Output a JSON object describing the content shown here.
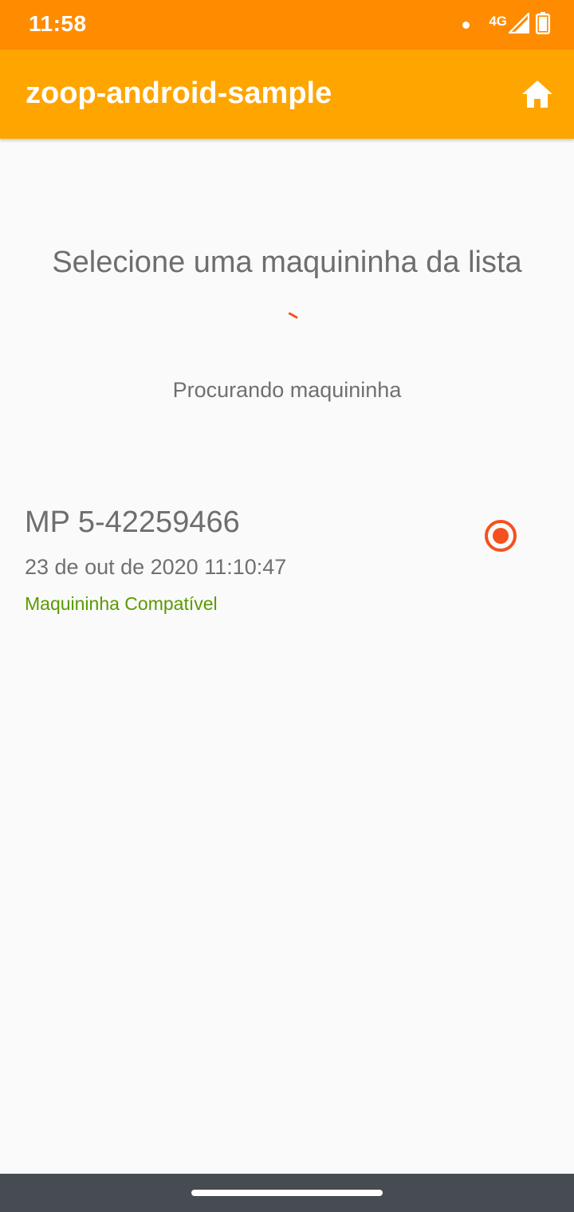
{
  "status_bar": {
    "time": "11:58",
    "network": "4G",
    "icons": [
      "notification-dot-icon",
      "signal-icon",
      "battery-icon"
    ]
  },
  "app_bar": {
    "title": "zoop-android-sample",
    "action_icon": "home-icon"
  },
  "main": {
    "heading": "Selecione uma maquininha da lista",
    "searching_text": "Procurando maquininha",
    "devices": [
      {
        "name": "MP 5-42259466",
        "date": "23 de out de 2020 11:10:47",
        "status": "Maquininha Compatível",
        "selected": true
      }
    ]
  },
  "colors": {
    "status_bar": "#ff8c00",
    "app_bar": "#ffa500",
    "accent": "#f4511e",
    "compatible": "#5a9a00",
    "nav_bar": "#474b52"
  }
}
